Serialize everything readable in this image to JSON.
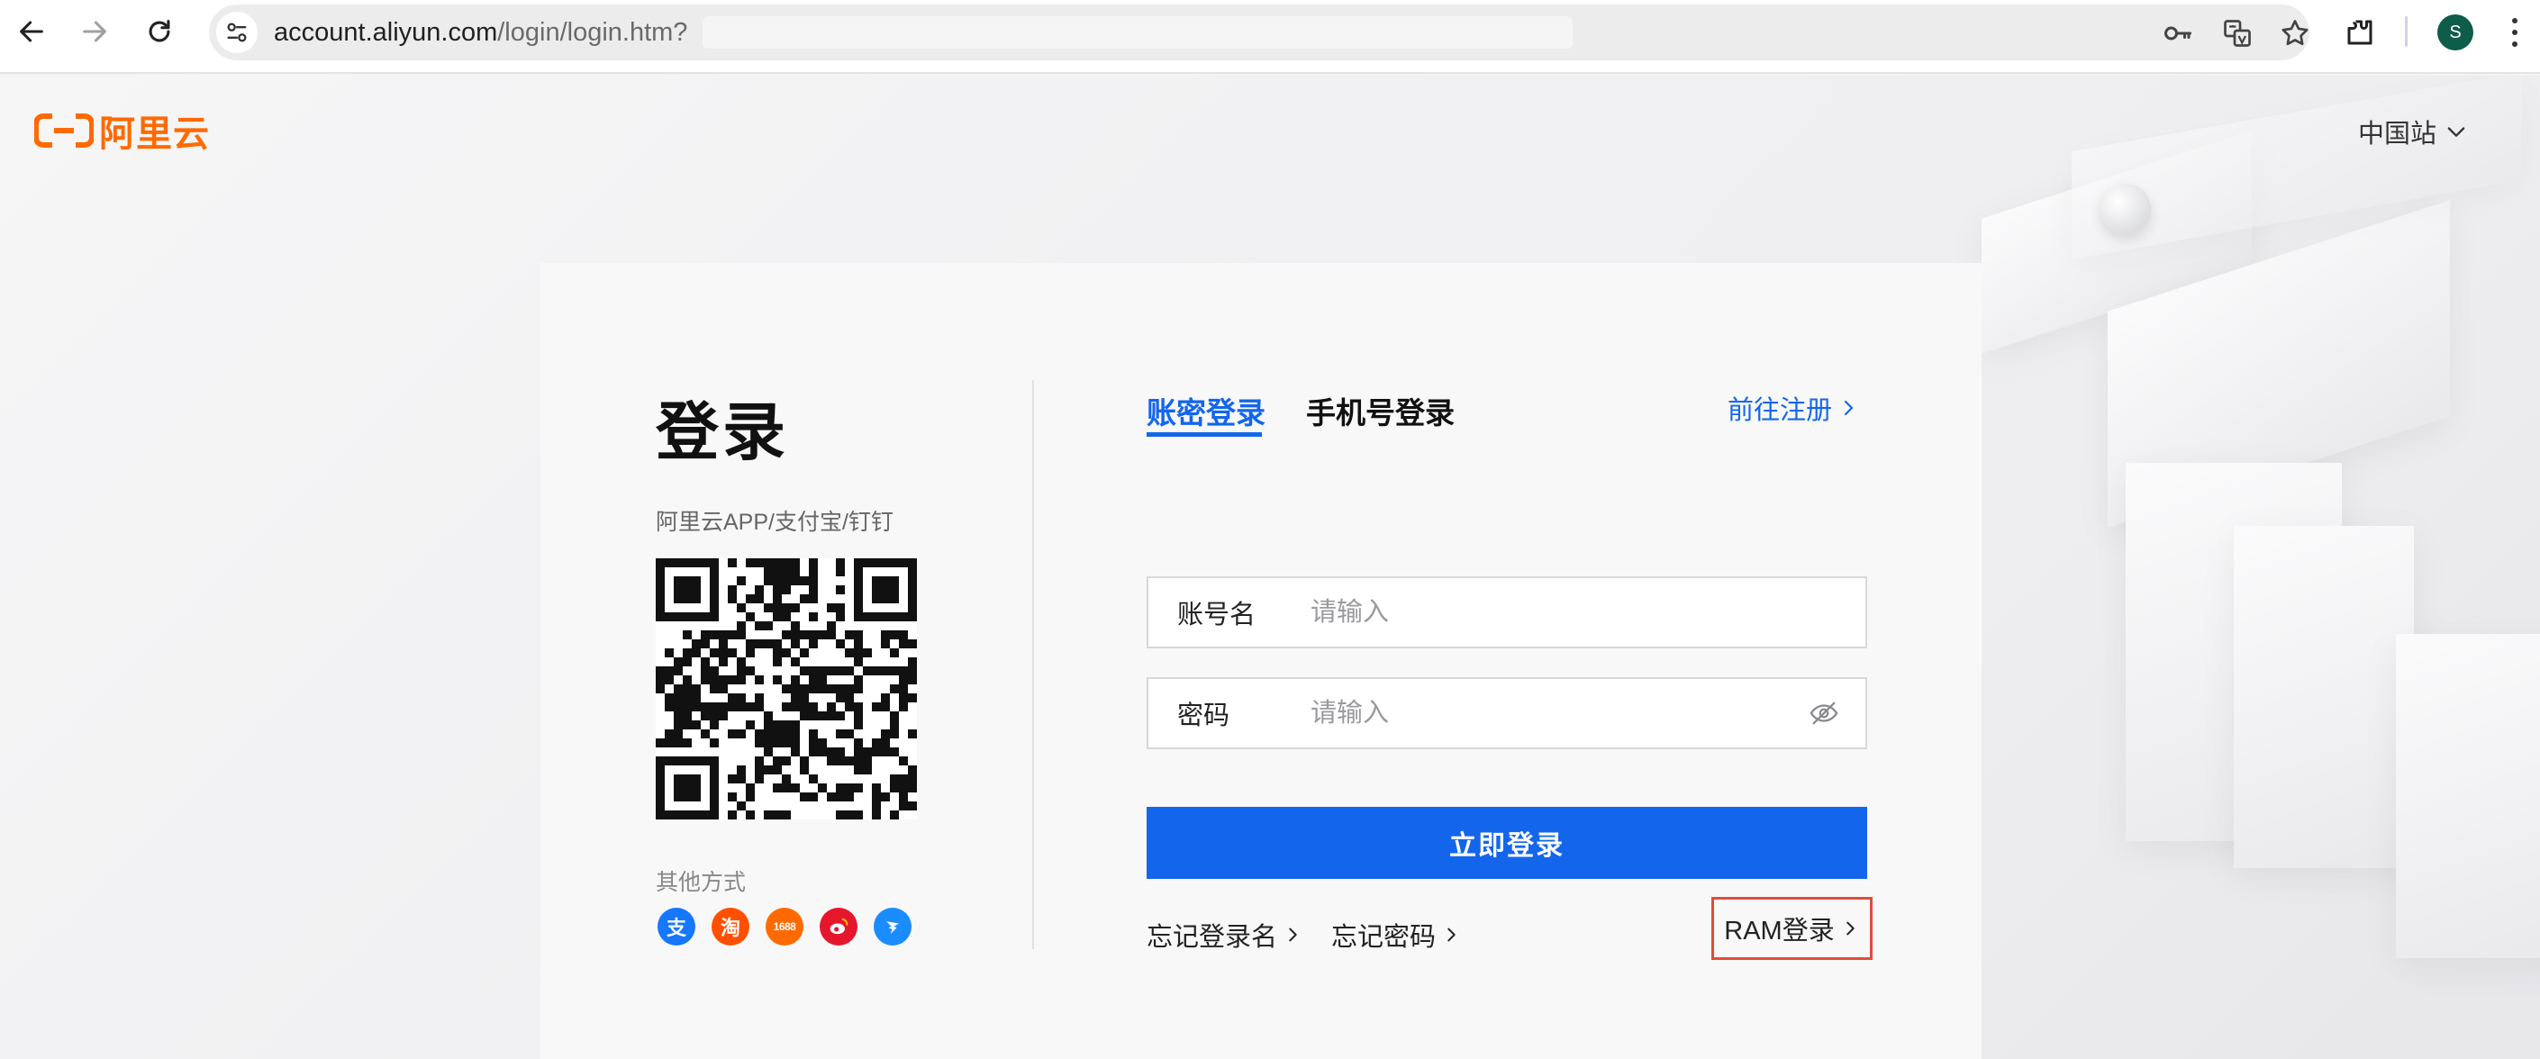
{
  "browser": {
    "url_host": "account.aliyun.com",
    "url_path": "/login/login.htm?",
    "profile_initial": "S",
    "icons": [
      "back-arrow-icon",
      "forward-arrow-icon",
      "reload-icon",
      "site-info-icon",
      "key-icon",
      "translate-icon",
      "star-icon",
      "extensions-icon",
      "more-icon"
    ]
  },
  "header": {
    "logo_text": "阿里云",
    "region": "中国站"
  },
  "login": {
    "title": "登录",
    "qr_caption": "阿里云APP/支付宝/钉钉",
    "other_methods_label": "其他方式",
    "socials": [
      {
        "name": "alipay",
        "glyph": "支",
        "color": "#1677ff"
      },
      {
        "name": "taobao",
        "glyph": "淘",
        "color": "#ff5000"
      },
      {
        "name": "1688",
        "glyph": "1688",
        "color": "#ff6a00"
      },
      {
        "name": "weibo",
        "glyph": "",
        "color": "#e6162d"
      },
      {
        "name": "dingtalk",
        "glyph": "",
        "color": "#1a8cff"
      }
    ],
    "tabs": [
      {
        "label": "账密登录",
        "active": true
      },
      {
        "label": "手机号登录",
        "active": false
      }
    ],
    "register_label": "前往注册",
    "account": {
      "label": "账号名",
      "placeholder": "请输入",
      "value": ""
    },
    "password": {
      "label": "密码",
      "placeholder": "请输入",
      "value": ""
    },
    "submit_label": "立即登录",
    "forgot_name_label": "忘记登录名",
    "forgot_password_label": "忘记密码",
    "ram_label": "RAM登录"
  },
  "colors": {
    "brand_orange": "#ff6a00",
    "primary_blue": "#1366ec",
    "highlight_red": "#e04c3c"
  }
}
